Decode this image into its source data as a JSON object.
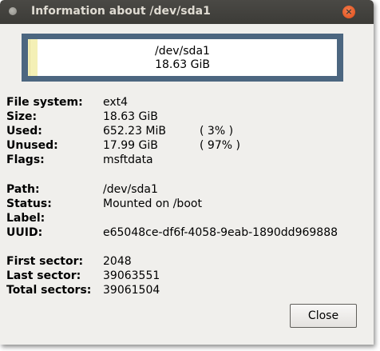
{
  "window": {
    "title": "Information about /dev/sda1",
    "close_glyph": "×"
  },
  "partition_graphic": {
    "path": "/dev/sda1",
    "size": "18.63 GiB",
    "used_fraction": 0.03,
    "colors": {
      "border": "#4c6680",
      "used": "#f4f0b6",
      "unused": "#ffffff"
    }
  },
  "details": {
    "file_system": {
      "label": "File system:",
      "value": "ext4"
    },
    "size": {
      "label": "Size:",
      "value": "18.63 GiB"
    },
    "used": {
      "label": "Used:",
      "value": "652.23 MiB",
      "percent": "( 3% )"
    },
    "unused": {
      "label": "Unused:",
      "value": "17.99 GiB",
      "percent": "( 97% )"
    },
    "flags": {
      "label": "Flags:",
      "value": "msftdata"
    },
    "path": {
      "label": "Path:",
      "value": "/dev/sda1"
    },
    "status": {
      "label": "Status:",
      "value": "Mounted on /boot"
    },
    "label": {
      "label": "Label:",
      "value": ""
    },
    "uuid": {
      "label": "UUID:",
      "value": "e65048ce-df6f-4058-9eab-1890dd969888"
    },
    "first_sector": {
      "label": "First sector:",
      "value": "2048"
    },
    "last_sector": {
      "label": "Last sector:",
      "value": "39063551"
    },
    "total_sectors": {
      "label": "Total sectors:",
      "value": "39061504"
    }
  },
  "buttons": {
    "close_label": "Close"
  },
  "icons": {
    "window_icon": "window-menu-icon",
    "close_icon": "close-icon"
  }
}
